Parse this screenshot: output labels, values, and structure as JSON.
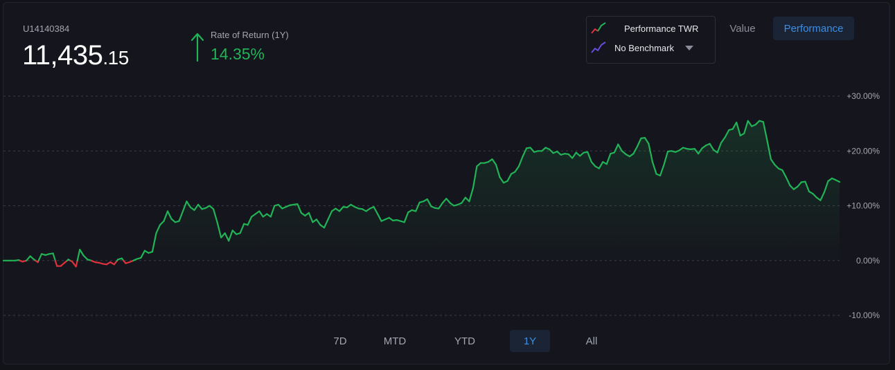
{
  "account": {
    "id": "U14140384",
    "balance_main": "11,435",
    "balance_cents": ".15"
  },
  "rate_of_return": {
    "label": "Rate of Return (1Y)",
    "value": "14.35%",
    "arrow_icon": "arrow-up-icon"
  },
  "legend": {
    "primary": "Performance TWR",
    "benchmark": "No Benchmark",
    "primary_icon": "line-chart-icon",
    "benchmark_icon": "line-chart-icon"
  },
  "view_toggle": {
    "value_label": "Value",
    "performance_label": "Performance",
    "selected": "Performance"
  },
  "ranges": [
    "7D",
    "MTD",
    "YTD",
    "1Y",
    "All"
  ],
  "selected_range": "1Y",
  "colors": {
    "positive": "#22b357",
    "negative": "#e0313e",
    "accent": "#3a8ee6",
    "benchmark": "#6a4be0"
  },
  "chart_data": {
    "type": "line",
    "title": "",
    "xlabel": "",
    "ylabel": "",
    "ylim": [
      -10,
      30
    ],
    "y_ticks": [
      "+30.00%",
      "+20.00%",
      "+10.00%",
      "0.00%",
      "-10.00%"
    ],
    "y_tick_values": [
      30,
      20,
      10,
      0,
      -10
    ],
    "grid": true,
    "series": [
      {
        "name": "Performance TWR",
        "values": [
          0,
          0,
          0,
          0,
          0.1,
          -0.2,
          0,
          0.8,
          0.2,
          -0.3,
          1.2,
          1,
          1.2,
          1.3,
          -1,
          -1,
          -0.4,
          0.2,
          -0.2,
          -1.1,
          2,
          0.9,
          0.2,
          0,
          -0.3,
          -0.4,
          -0.6,
          -0.7,
          -0.3,
          -0.7,
          0.2,
          0.4,
          -0.5,
          -0.3,
          0,
          0.3,
          0.5,
          1.8,
          1.4,
          1.6,
          5,
          6.5,
          7.2,
          9,
          7.6,
          7,
          7.2,
          9,
          10.8,
          9.7,
          9.2,
          10.2,
          9.4,
          9.6,
          10,
          9.4,
          7,
          4.2,
          5,
          3.6,
          5.5,
          4.8,
          5,
          6.7,
          6.5,
          8,
          8.5,
          9,
          8,
          8.5,
          8,
          10,
          10.2,
          9.5,
          9.8,
          10.1,
          10.2,
          10.3,
          8.7,
          8.2,
          8.7,
          7,
          7.5,
          6.5,
          6,
          7.5,
          9,
          9.5,
          9,
          9.8,
          9.7,
          10.2,
          9.8,
          9.5,
          9.4,
          9,
          9.5,
          9.8,
          8.5,
          7.2,
          7.5,
          7.8,
          7.3,
          7.4,
          7.2,
          7,
          8.8,
          9.2,
          9,
          10.6,
          10.8,
          11.2,
          9.9,
          9.6,
          9.5,
          10.5,
          11.3,
          10.5,
          10,
          10.2,
          10.5,
          11.5,
          10.8,
          13.2,
          17.2,
          17.8,
          17.8,
          18,
          18.5,
          17.5,
          15.2,
          14.2,
          14.5,
          15.8,
          16.2,
          17.2,
          19,
          20.5,
          20.6,
          19.8,
          20,
          20,
          20.6,
          20.3,
          19.6,
          19.9,
          19.3,
          19.5,
          19.4,
          18.7,
          19.7,
          19.1,
          19.7,
          19.8,
          18,
          17.2,
          16.8,
          18,
          17.6,
          19.5,
          19.7,
          21.2,
          20,
          19.4,
          19,
          19.5,
          20.8,
          22.3,
          22.4,
          21.3,
          18,
          15.8,
          15.5,
          17.5,
          19.9,
          20,
          19.8,
          20.1,
          20.6,
          20.4,
          20.3,
          20.4,
          19.5,
          20.5,
          21,
          21.3,
          20.2,
          19.7,
          21.5,
          22.5,
          23.8,
          24,
          25.2,
          22.8,
          23.2,
          25.5,
          24.5,
          24.8,
          25.5,
          25.3,
          22,
          18.5,
          17.5,
          16.8,
          16.5,
          15.2,
          13.7,
          13,
          13.5,
          14.3,
          14.4,
          12.6,
          12.2,
          11.5,
          11,
          12.5,
          14.5,
          15,
          14.7,
          14.35
        ]
      },
      {
        "name": "No Benchmark",
        "values": []
      }
    ]
  }
}
